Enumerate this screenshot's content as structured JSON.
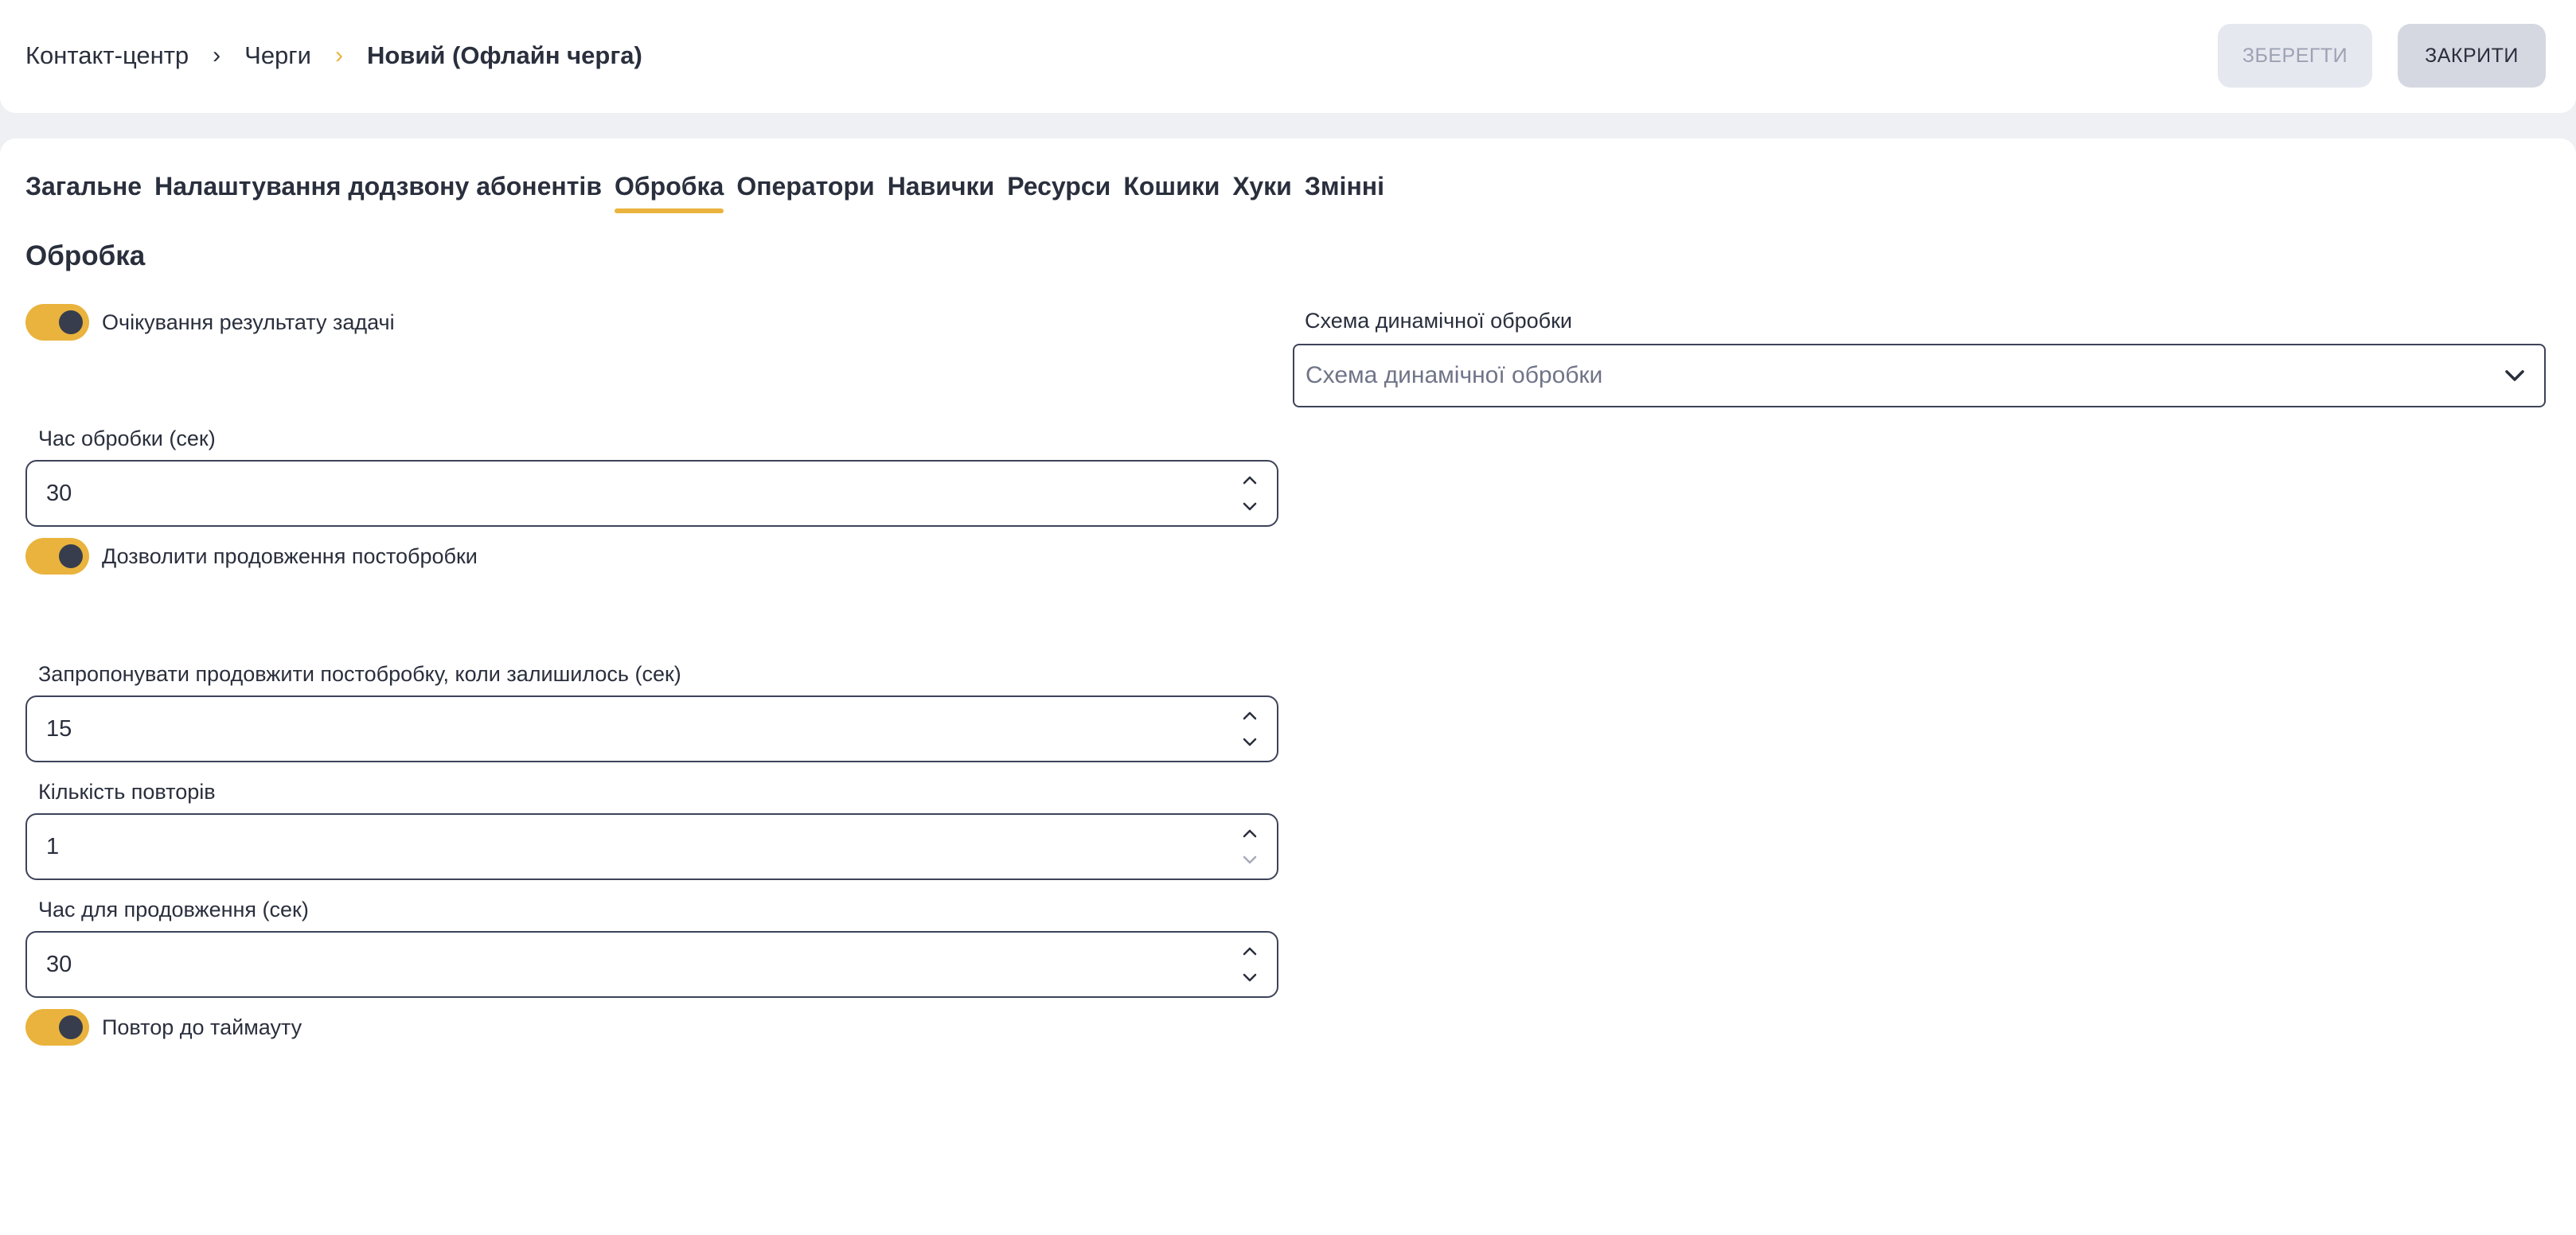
{
  "breadcrumb": {
    "items": [
      "Контакт-центр",
      "Черги"
    ],
    "separator": "›",
    "current": "Новий (Офлайн черга)"
  },
  "header": {
    "save_label": "ЗБЕРЕГТИ",
    "close_label": "ЗАКРИТИ"
  },
  "tabs": [
    {
      "label": "Загальне",
      "active": false
    },
    {
      "label": "Налаштування додзвону абонентів",
      "active": false
    },
    {
      "label": "Обробка",
      "active": true
    },
    {
      "label": "Оператори",
      "active": false
    },
    {
      "label": "Навички",
      "active": false
    },
    {
      "label": "Ресурси",
      "active": false
    },
    {
      "label": "Кошики",
      "active": false
    },
    {
      "label": "Хуки",
      "active": false
    },
    {
      "label": "Змінні",
      "active": false
    }
  ],
  "section_title": "Обробка",
  "toggles": {
    "await_result": {
      "label": "Очікування результату задачі",
      "on": true
    },
    "allow_extension": {
      "label": "Дозволити продовження постобробки",
      "on": true
    },
    "repeat_until_timeout": {
      "label": "Повтор до таймауту",
      "on": true
    }
  },
  "fields": {
    "processing_time": {
      "label": "Час обробки (сек)",
      "value": "30"
    },
    "offer_extend": {
      "label": "Запропонувати продовжити постобробку, коли залишилось (сек)",
      "value": "15"
    },
    "repeat_count": {
      "label": "Кількість повторів",
      "value": "1"
    },
    "extend_time": {
      "label": "Час для продовження (сек)",
      "value": "30"
    }
  },
  "dynamic_schema": {
    "label": "Схема динамічної обробки",
    "placeholder": "Схема динамічної обробки"
  },
  "colors": {
    "accent": "#e9b33d",
    "text": "#2a2f3d",
    "border": "#3d4359"
  }
}
